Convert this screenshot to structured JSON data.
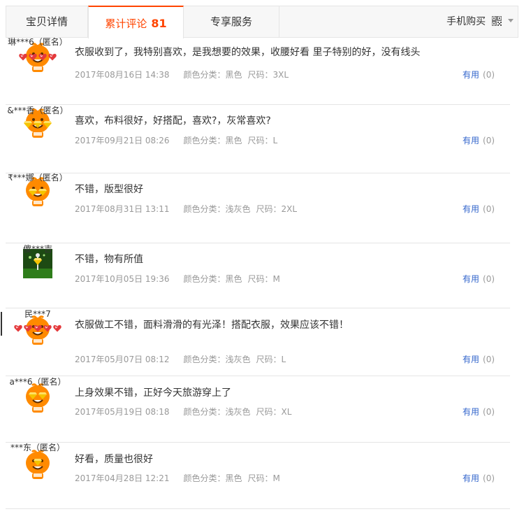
{
  "tabs": {
    "detail": "宝贝详情",
    "reviews": "累计评论",
    "reviews_count": "81",
    "service": "专享服务",
    "mobile": "手机购买"
  },
  "colors": {
    "accent": "#ff4400",
    "link": "#3366cc",
    "meta": "#999999",
    "avatar_orange": "#ff8a00"
  },
  "reviews": [
    {
      "user": "琳***6（匿名）",
      "level_count": 4,
      "level_type": "heart",
      "avatar": "orange-mascot",
      "content": "衣服收到了，我特别喜欢，是我想要的效果，收腰好看 里子特别的好，没有线头",
      "date": "2017年08月16日 14:38",
      "color_label": "颜色分类：",
      "color": "黑色",
      "size_label": "尺码：",
      "size": "3XL",
      "useful": "有用",
      "useful_count": "(0)"
    },
    {
      "user": "&***香（匿名）",
      "level_count": 3,
      "level_type": "diamond",
      "avatar": "orange-mascot",
      "content": "喜欢，布料很好，好搭配，喜欢?，灰常喜欢?",
      "date": "2017年09月21日 08:26",
      "color_label": "颜色分类：",
      "color": "黑色",
      "size_label": "尺码：",
      "size": "L",
      "useful": "有用",
      "useful_count": "(0)"
    },
    {
      "user": "₹***娜（匿名）",
      "level_count": 2,
      "level_type": "diamond",
      "avatar": "orange-mascot",
      "content": "不错，版型很好",
      "date": "2017年08月31日 13:11",
      "color_label": "颜色分类：",
      "color": "浅灰色",
      "size_label": "尺码：",
      "size": "2XL",
      "useful": "有用",
      "useful_count": "(0)"
    },
    {
      "user": "傻***吉",
      "level_count": 1,
      "level_type": "diamond",
      "avatar": "green-photo",
      "content": "不错，物有所值",
      "date": "2017年10月05日 19:36",
      "color_label": "颜色分类：",
      "color": "黑色",
      "size_label": "尺码：",
      "size": "M",
      "useful": "有用",
      "useful_count": "(0)"
    },
    {
      "user": "民***7",
      "level_count": 5,
      "level_type": "heart",
      "avatar": "orange-mascot",
      "content": "衣服做工不错，面料滑滑的有光泽！搭配衣服，效果应该不错！",
      "date": "2017年05月07日 08:12",
      "color_label": "颜色分类：",
      "color": "浅灰色",
      "size_label": "尺码：",
      "size": "L",
      "useful": "有用",
      "useful_count": "(0)"
    },
    {
      "user": "a***6（匿名）",
      "level_count": 2,
      "level_type": "diamond",
      "avatar": "orange-mascot",
      "content": "上身效果不错，正好今天旅游穿上了",
      "date": "2017年05月19日 08:18",
      "color_label": "颜色分类：",
      "color": "浅灰色",
      "size_label": "尺码：",
      "size": "XL",
      "useful": "有用",
      "useful_count": "(0)"
    },
    {
      "user": "***东（匿名）",
      "level_count": 1,
      "level_type": "diamond",
      "avatar": "orange-mascot",
      "content": "好看，质量也很好",
      "date": "2017年04月28日 12:21",
      "color_label": "颜色分类：",
      "color": "黑色",
      "size_label": "尺码：",
      "size": "M",
      "useful": "有用",
      "useful_count": "(0)"
    }
  ]
}
